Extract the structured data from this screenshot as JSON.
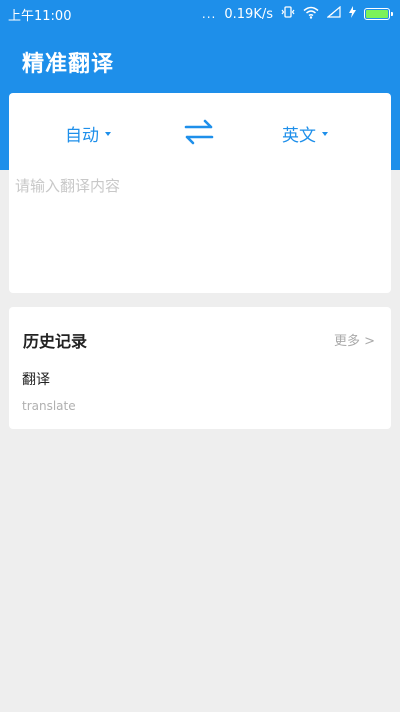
{
  "status": {
    "time": "上午11:00",
    "dots": "...",
    "speed": "0.19K/s",
    "battery_level": 1.0
  },
  "app": {
    "title": "精准翻译"
  },
  "translate": {
    "source_lang": "自动",
    "target_lang": "英文",
    "input_placeholder": "请输入翻译内容",
    "input_value": ""
  },
  "history": {
    "title": "历史记录",
    "more_label": "更多 >",
    "items": [
      {
        "source": "翻译",
        "translation": "translate"
      }
    ]
  },
  "colors": {
    "accent": "#1e8fea",
    "background": "#eeeeee"
  }
}
